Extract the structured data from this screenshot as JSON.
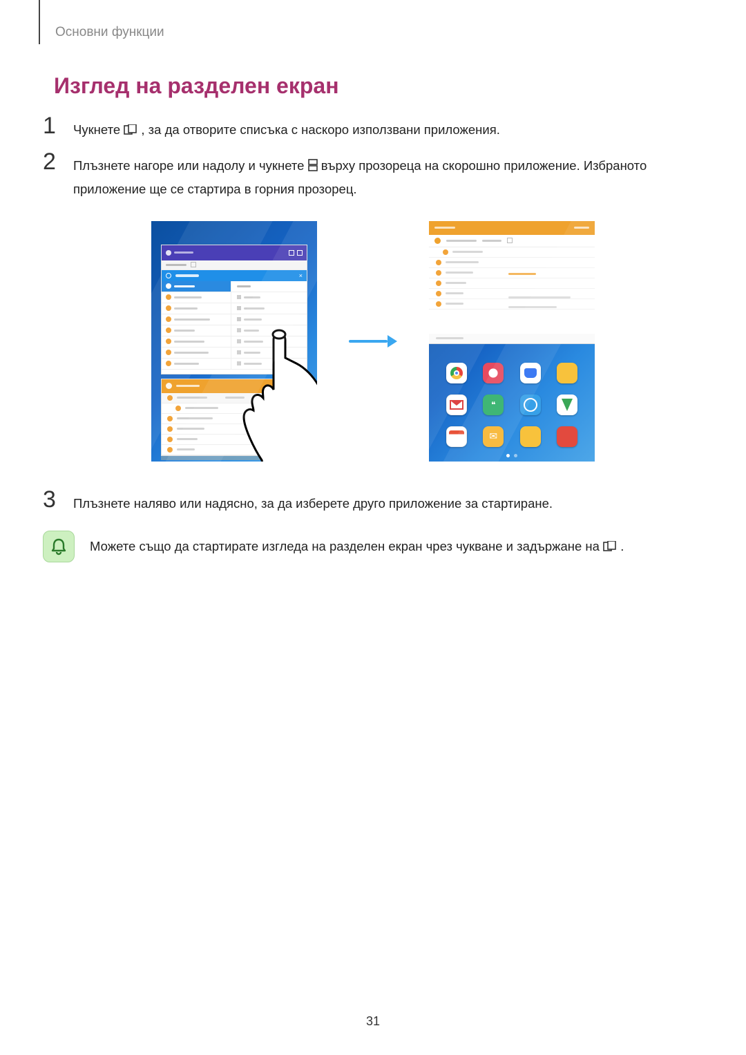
{
  "breadcrumb": "Основни функции",
  "section_title": "Изглед на разделен екран",
  "steps": {
    "s1a": "Чукнете ",
    "s1b": ", за да отворите списъка с наскоро използвани приложения.",
    "s2a": "Плъзнете нагоре или надолу и чукнете ",
    "s2b": " върху прозореца на скорошно приложение. Избраното приложение ще се стартира в горния прозорец.",
    "s3": "Плъзнете наляво или надясно, за да изберете друго приложение за стартиране."
  },
  "tip": {
    "a": "Можете също да стартирате изгледа на разделен екран чрез чукване и задържане на ",
    "b": "."
  },
  "page_number": "31",
  "step_nums": {
    "n1": "1",
    "n2": "2",
    "n3": "3"
  }
}
